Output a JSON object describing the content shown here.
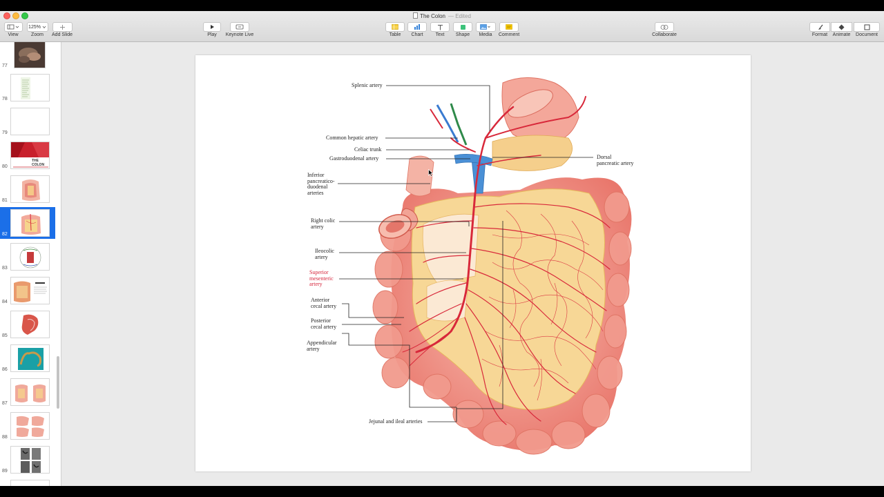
{
  "window": {
    "title": "The Colon",
    "status": "— Edited"
  },
  "toolbar": {
    "left": [
      {
        "name": "view",
        "label": "View",
        "icon": "sidebar-view-icon"
      },
      {
        "name": "zoom",
        "label": "Zoom",
        "value": "125%"
      },
      {
        "name": "add-slide",
        "label": "Add Slide",
        "icon": "plus-icon"
      }
    ],
    "play": {
      "label": "Play",
      "icon": "play-icon"
    },
    "keynote_live": {
      "label": "Keynote Live",
      "icon": "keynote-live-icon"
    },
    "insert": [
      {
        "label": "Table",
        "icon": "table-icon"
      },
      {
        "label": "Chart",
        "icon": "chart-icon"
      },
      {
        "label": "Text",
        "icon": "text-icon"
      },
      {
        "label": "Shape",
        "icon": "shape-icon"
      },
      {
        "label": "Media",
        "icon": "media-icon"
      },
      {
        "label": "Comment",
        "icon": "comment-icon"
      }
    ],
    "collaborate": {
      "label": "Collaborate",
      "icon": "collaborate-icon"
    },
    "right": [
      {
        "label": "Format",
        "icon": "format-brush-icon"
      },
      {
        "label": "Animate",
        "icon": "animate-diamond-icon"
      },
      {
        "label": "Document",
        "icon": "document-icon"
      }
    ]
  },
  "slides": [
    {
      "num": "77",
      "kind": "photo"
    },
    {
      "num": "78",
      "kind": "text"
    },
    {
      "num": "79",
      "kind": "blank"
    },
    {
      "num": "80",
      "kind": "title",
      "caption": "THE COLON"
    },
    {
      "num": "81",
      "kind": "anatomy"
    },
    {
      "num": "82",
      "kind": "anatomy",
      "selected": true
    },
    {
      "num": "83",
      "kind": "diagram"
    },
    {
      "num": "84",
      "kind": "anatomy-text"
    },
    {
      "num": "85",
      "kind": "anatomy"
    },
    {
      "num": "86",
      "kind": "photo-teal"
    },
    {
      "num": "87",
      "kind": "anatomy-pair"
    },
    {
      "num": "88",
      "kind": "anatomy-pair"
    },
    {
      "num": "89",
      "kind": "radiograph"
    }
  ],
  "figure": {
    "labels": {
      "splenic": "Splenic artery",
      "common_hepatic": "Common hepatic artery",
      "celiac": "Celiac trunk",
      "gastroduodenal": "Gastroduodenal artery",
      "dorsal_pancreatic_1": "Dorsal",
      "dorsal_pancreatic_2": "pancreatic artery",
      "inf_pd_1": "Inferior",
      "inf_pd_2": "pancreatico-",
      "inf_pd_3": "duodenal",
      "inf_pd_4": "arteries",
      "right_colic_1": "Right colic",
      "right_colic_2": "artery",
      "ileocolic_1": "Ileocolic",
      "ileocolic_2": "artery",
      "sma_1": "Superior",
      "sma_2": "mesenteric",
      "sma_3": "artery",
      "ant_cecal_1": "Anterior",
      "ant_cecal_2": "cecal artery",
      "post_cecal_1": "Posterior",
      "post_cecal_2": "cecal artery",
      "appendicular_1": "Appendicular",
      "appendicular_2": "artery",
      "jejunal": "Jejunal and ileal arteries"
    }
  }
}
